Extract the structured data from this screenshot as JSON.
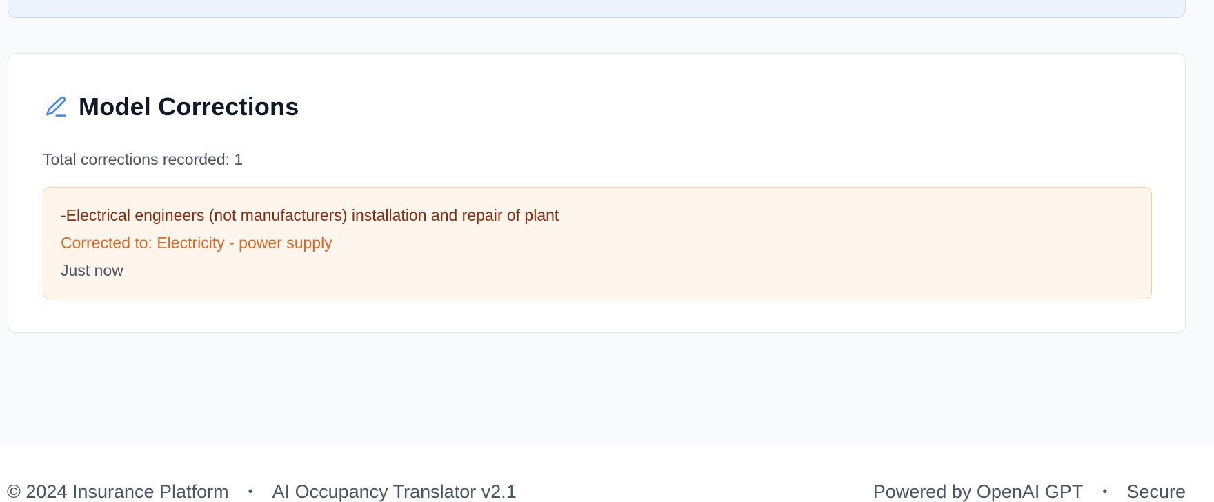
{
  "app": {
    "accent_color": "#3b82f6"
  },
  "corrections_card": {
    "icon": "pencil-icon",
    "title": "Model Corrections",
    "total_label": "Total corrections recorded: 1",
    "items": [
      {
        "original": "-Electrical engineers (not manufacturers) installation and repair of plant",
        "corrected": "Corrected to: Electricity - power supply",
        "time": "Just now"
      }
    ]
  },
  "footer": {
    "copyright": "© 2024 Insurance Platform",
    "product": "AI Occupancy Translator v2.1",
    "powered_by": "Powered by OpenAI GPT",
    "secure": "Secure",
    "separator": "•"
  }
}
